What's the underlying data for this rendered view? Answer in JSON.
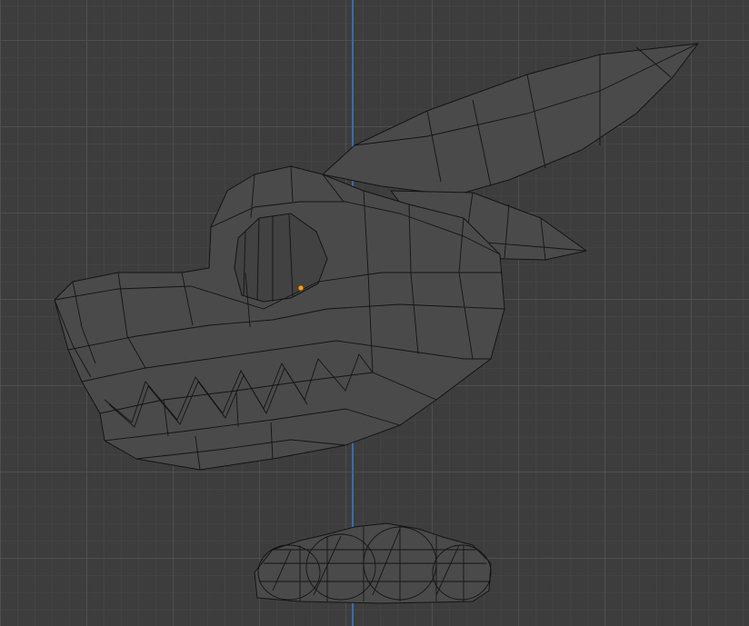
{
  "viewport": {
    "background_color": "#3d3d3d",
    "grid_color": "#505050",
    "axis_color": "#3e6aa8",
    "origin_marker_color": "#f0a020"
  },
  "objects": [
    {
      "name": "creature-head-mesh",
      "icon": "mesh-object"
    },
    {
      "name": "feet-mesh",
      "icon": "mesh-object"
    }
  ]
}
